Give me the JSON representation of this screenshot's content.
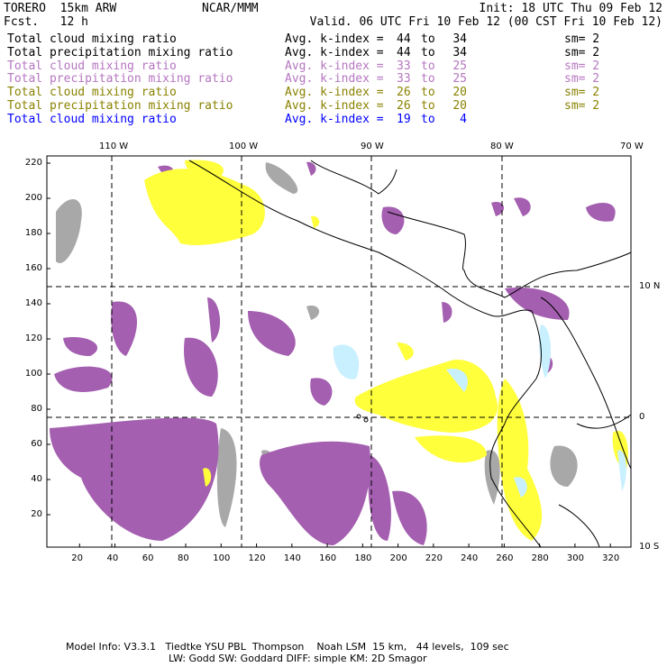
{
  "header": {
    "model": "TORERO  15km ARW",
    "org": "NCAR/MMM",
    "init": "Init: 18 UTC Thu 09 Feb 12",
    "fcst": "Fcst.   12 h",
    "valid": "Valid. 06 UTC Fri 10 Feb 12 (00 CST Fri 10 Feb 12)"
  },
  "legend": [
    {
      "field": "Total cloud mixing ratio",
      "avg": "Avg. k-index =",
      "from": "44",
      "to_word": "to",
      "to": "34",
      "sm": "sm= 2",
      "color": "#000000"
    },
    {
      "field": "Total precipitation mixing ratio",
      "avg": "Avg. k-index =",
      "from": "44",
      "to_word": "to",
      "to": "34",
      "sm": "sm= 2",
      "color": "#000000"
    },
    {
      "field": "Total cloud mixing ratio",
      "avg": "Avg. k-index =",
      "from": "33",
      "to_word": "to",
      "to": "25",
      "sm": "sm= 2",
      "color": "#b576c0"
    },
    {
      "field": "Total precipitation mixing ratio",
      "avg": "Avg. k-index =",
      "from": "33",
      "to_word": "to",
      "to": "25",
      "sm": "sm= 2",
      "color": "#b576c0"
    },
    {
      "field": "Total cloud mixing ratio",
      "avg": "Avg. k-index =",
      "from": "26",
      "to_word": "to",
      "to": "20",
      "sm": "sm= 2",
      "color": "#8a8200"
    },
    {
      "field": "Total precipitation mixing ratio",
      "avg": "Avg. k-index =",
      "from": "26",
      "to_word": "to",
      "to": "20",
      "sm": "sm= 2",
      "color": "#8a8200"
    },
    {
      "field": "Total cloud mixing ratio",
      "avg": "Avg. k-index =",
      "from": "19",
      "to_word": "to",
      "to": "4",
      "sm": "",
      "color": "#0000ff"
    }
  ],
  "map": {
    "x_ticks": [
      "20",
      "40",
      "60",
      "80",
      "100",
      "120",
      "140",
      "160",
      "180",
      "200",
      "220",
      "240",
      "260",
      "280",
      "300",
      "320"
    ],
    "y_ticks": [
      "20",
      "40",
      "60",
      "80",
      "100",
      "120",
      "140",
      "160",
      "180",
      "200",
      "220"
    ],
    "lon_labels": [
      "110 W",
      "100 W",
      "90 W",
      "80 W",
      "70 W"
    ],
    "lat_labels": [
      "10 N",
      "0",
      "10 S"
    ],
    "colors": {
      "gray": "#a8a8a8",
      "purple": "#a45fb0",
      "yellow": "#ffff3c",
      "cyan": "#c8f0ff"
    }
  },
  "footer": {
    "line1": "Model Info: V3.3.1   Tiedtke YSU PBL  Thompson    Noah LSM  15 km,   44 levels,  109 sec",
    "line2": "LW: Godd SW: Goddard DIFF: simple KM: 2D Smagor"
  }
}
